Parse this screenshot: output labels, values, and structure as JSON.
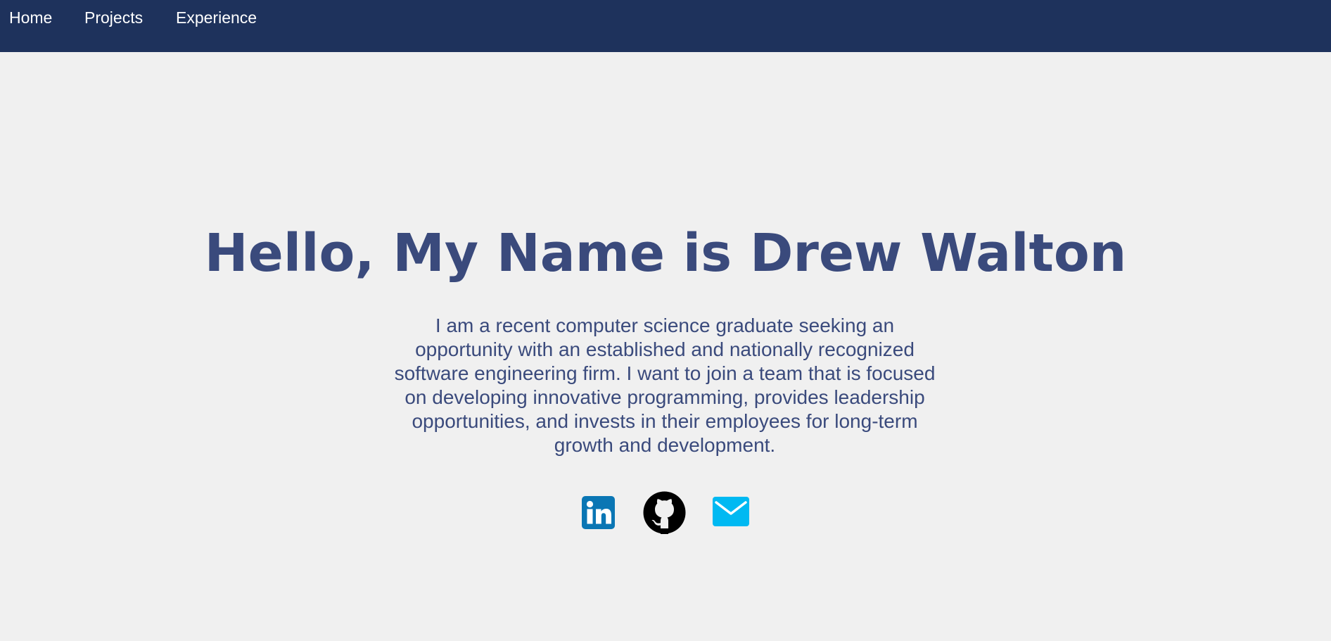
{
  "nav": {
    "items": [
      {
        "label": "Home"
      },
      {
        "label": "Projects"
      },
      {
        "label": "Experience"
      }
    ]
  },
  "hero": {
    "title": "Hello, My Name is Drew Walton",
    "bio": "I am a recent computer science graduate seeking an opportunity with an established and nationally recognized software engineering firm. I want to join a team that is focused on developing innovative programming, provides leadership opportunities, and invests in their employees for long-term growth and development."
  },
  "social": {
    "icons": [
      "linkedin-icon",
      "github-icon",
      "email-icon"
    ]
  },
  "colors": {
    "navbar": "#1e325c",
    "background": "#f0f0f0",
    "heading": "#3a4a7c",
    "linkedin": "#0a76b4",
    "github": "#000000",
    "email": "#00b9f2"
  }
}
